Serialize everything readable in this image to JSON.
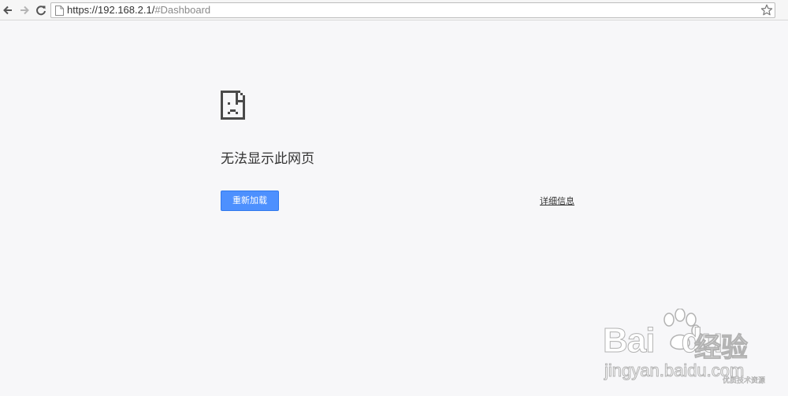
{
  "browser": {
    "url_host": "https://192.168.2.1/",
    "url_rest": "#Dashboard",
    "icons": {
      "back": "back-arrow-icon",
      "forward": "forward-arrow-icon",
      "reload": "reload-icon",
      "page": "page-icon",
      "bookmark": "star-icon"
    }
  },
  "error_page": {
    "icon": "sad-page-icon",
    "title": "无法显示此网页",
    "reload_label": "重新加载",
    "details_label": "详细信息"
  },
  "watermark": {
    "brand": "Bai",
    "brand_end": "du",
    "brand_cn": "经验",
    "url": "jingyan.baidu.com",
    "small": "优质技术资源"
  },
  "colors": {
    "background": "#f7f7f9",
    "button": "#4d90fe",
    "button_border": "#3079ed",
    "text": "#333333",
    "url_secondary": "#8a8a8a"
  }
}
